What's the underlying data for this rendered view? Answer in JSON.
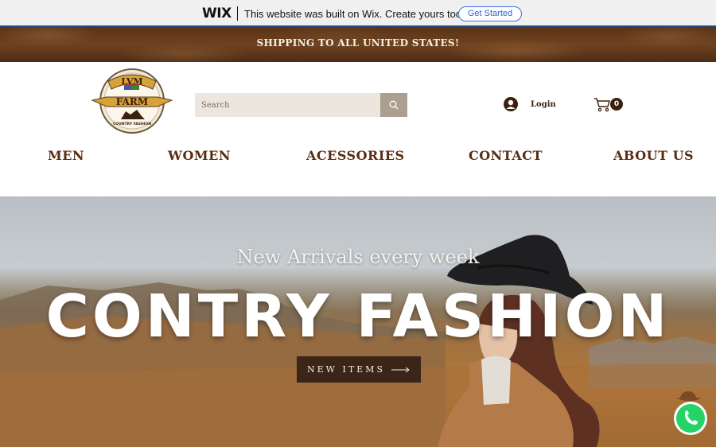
{
  "wix_bar": {
    "logo": "WIX",
    "message": "This website was built on Wix. Create yours today.",
    "cta": "Get Started"
  },
  "shipping": {
    "text": "SHIPPING TO ALL UNITED STATES!"
  },
  "header": {
    "logo_top": "LVM",
    "logo_middle": "FARM",
    "logo_bottom": "COUNTRY FASHION",
    "search_placeholder": "Search",
    "login": "Login",
    "cart_count": "0"
  },
  "nav": {
    "items": [
      "MEN",
      "WOMEN",
      "ACESSORIES",
      "CONTACT",
      "ABOUT US"
    ]
  },
  "hero": {
    "subtitle": "New Arrivals every week",
    "title": "CONTRY FASHION",
    "button": "NEW ITEMS"
  },
  "colors": {
    "brown": "#5a2d12",
    "dark": "#3a2518",
    "wix_blue": "#2f62d6",
    "whatsapp": "#25d366"
  },
  "icons": [
    "search-icon",
    "user-avatar-icon",
    "cart-icon",
    "arrow-right-icon",
    "whatsapp-icon"
  ]
}
